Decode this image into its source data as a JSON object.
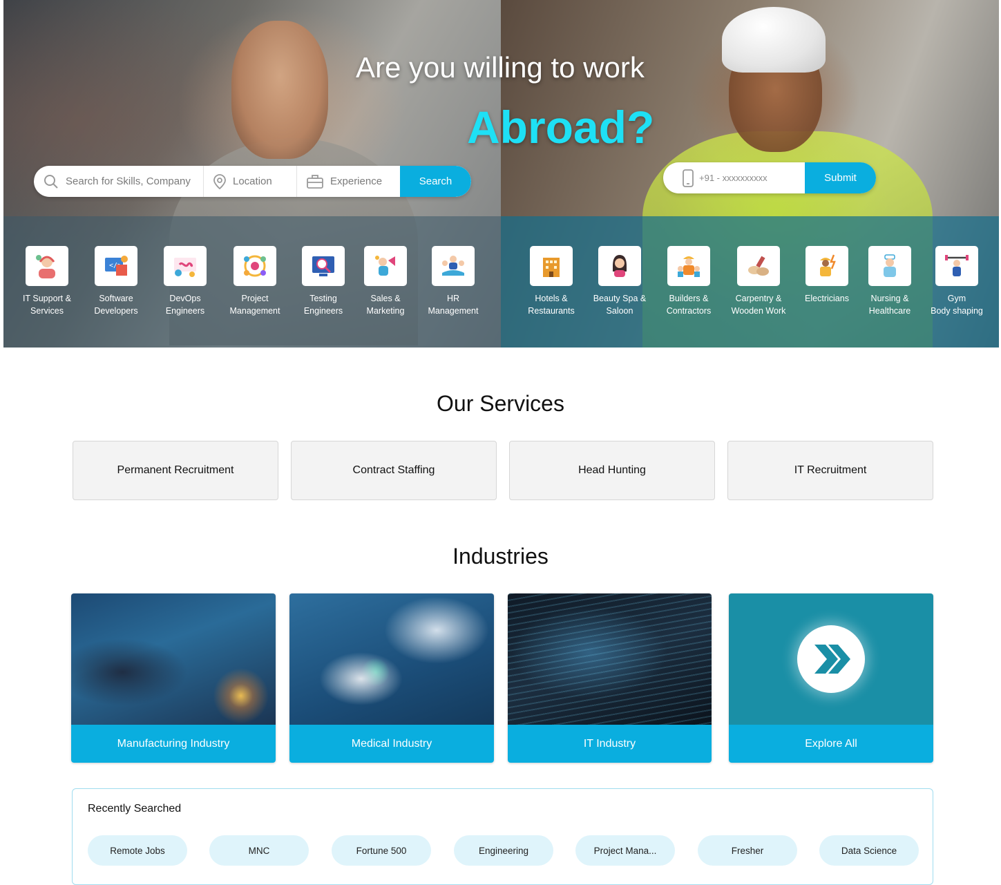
{
  "hero": {
    "headline": "Are you willing to work",
    "headline_highlight": "Abroad?",
    "search": {
      "skills_placeholder": "Search for Skills, Company",
      "location_placeholder": "Location",
      "experience_placeholder": "Experience",
      "button": "Search"
    },
    "phone": {
      "placeholder": "+91 - xxxxxxxxxx",
      "button": "Submit"
    },
    "categories_left": [
      {
        "line1": "IT Support &",
        "line2": "Services",
        "icon": "it-support-icon"
      },
      {
        "line1": "Software",
        "line2": "Developers",
        "icon": "software-developer-icon"
      },
      {
        "line1": "DevOps",
        "line2": "Engineers",
        "icon": "devops-icon"
      },
      {
        "line1": "Project",
        "line2": "Management",
        "icon": "project-management-icon"
      },
      {
        "line1": "Testing",
        "line2": "Engineers",
        "icon": "testing-icon"
      },
      {
        "line1": "Sales &",
        "line2": "Marketing",
        "icon": "sales-marketing-icon"
      },
      {
        "line1": "HR",
        "line2": "Management",
        "icon": "hr-management-icon"
      }
    ],
    "categories_right": [
      {
        "line1": "Hotels &",
        "line2": "Restaurants",
        "icon": "hotel-icon"
      },
      {
        "line1": "Beauty Spa &",
        "line2": "Saloon",
        "icon": "beauty-spa-icon"
      },
      {
        "line1": "Builders &",
        "line2": "Contractors",
        "icon": "builders-icon"
      },
      {
        "line1": "Carpentry &",
        "line2": "Wooden Work",
        "icon": "carpentry-icon"
      },
      {
        "line1": "Electricians",
        "line2": "",
        "icon": "electrician-icon"
      },
      {
        "line1": "Nursing &",
        "line2": "Healthcare",
        "icon": "nursing-icon"
      },
      {
        "line1": "Gym",
        "line2": "Body shaping",
        "icon": "gym-icon"
      }
    ]
  },
  "services": {
    "title": "Our Services",
    "items": [
      "Permanent Recruitment",
      "Contract Staffing",
      "Head Hunting",
      "IT Recruitment"
    ]
  },
  "industries": {
    "title": "Industries",
    "items": [
      "Manufacturing Industry",
      "Medical Industry",
      "IT Industry",
      "Explore All"
    ]
  },
  "recent": {
    "title": "Recently Searched",
    "chips": [
      "Remote Jobs",
      "MNC",
      "Fortune 500",
      "Engineering",
      "Project Mana...",
      "Fresher",
      "Data Science"
    ]
  },
  "colors": {
    "accent": "#0aaedf",
    "headline_highlight": "#1ee0f5",
    "explore_bg": "#1a8fa6",
    "chip_bg": "#dff4fb"
  }
}
